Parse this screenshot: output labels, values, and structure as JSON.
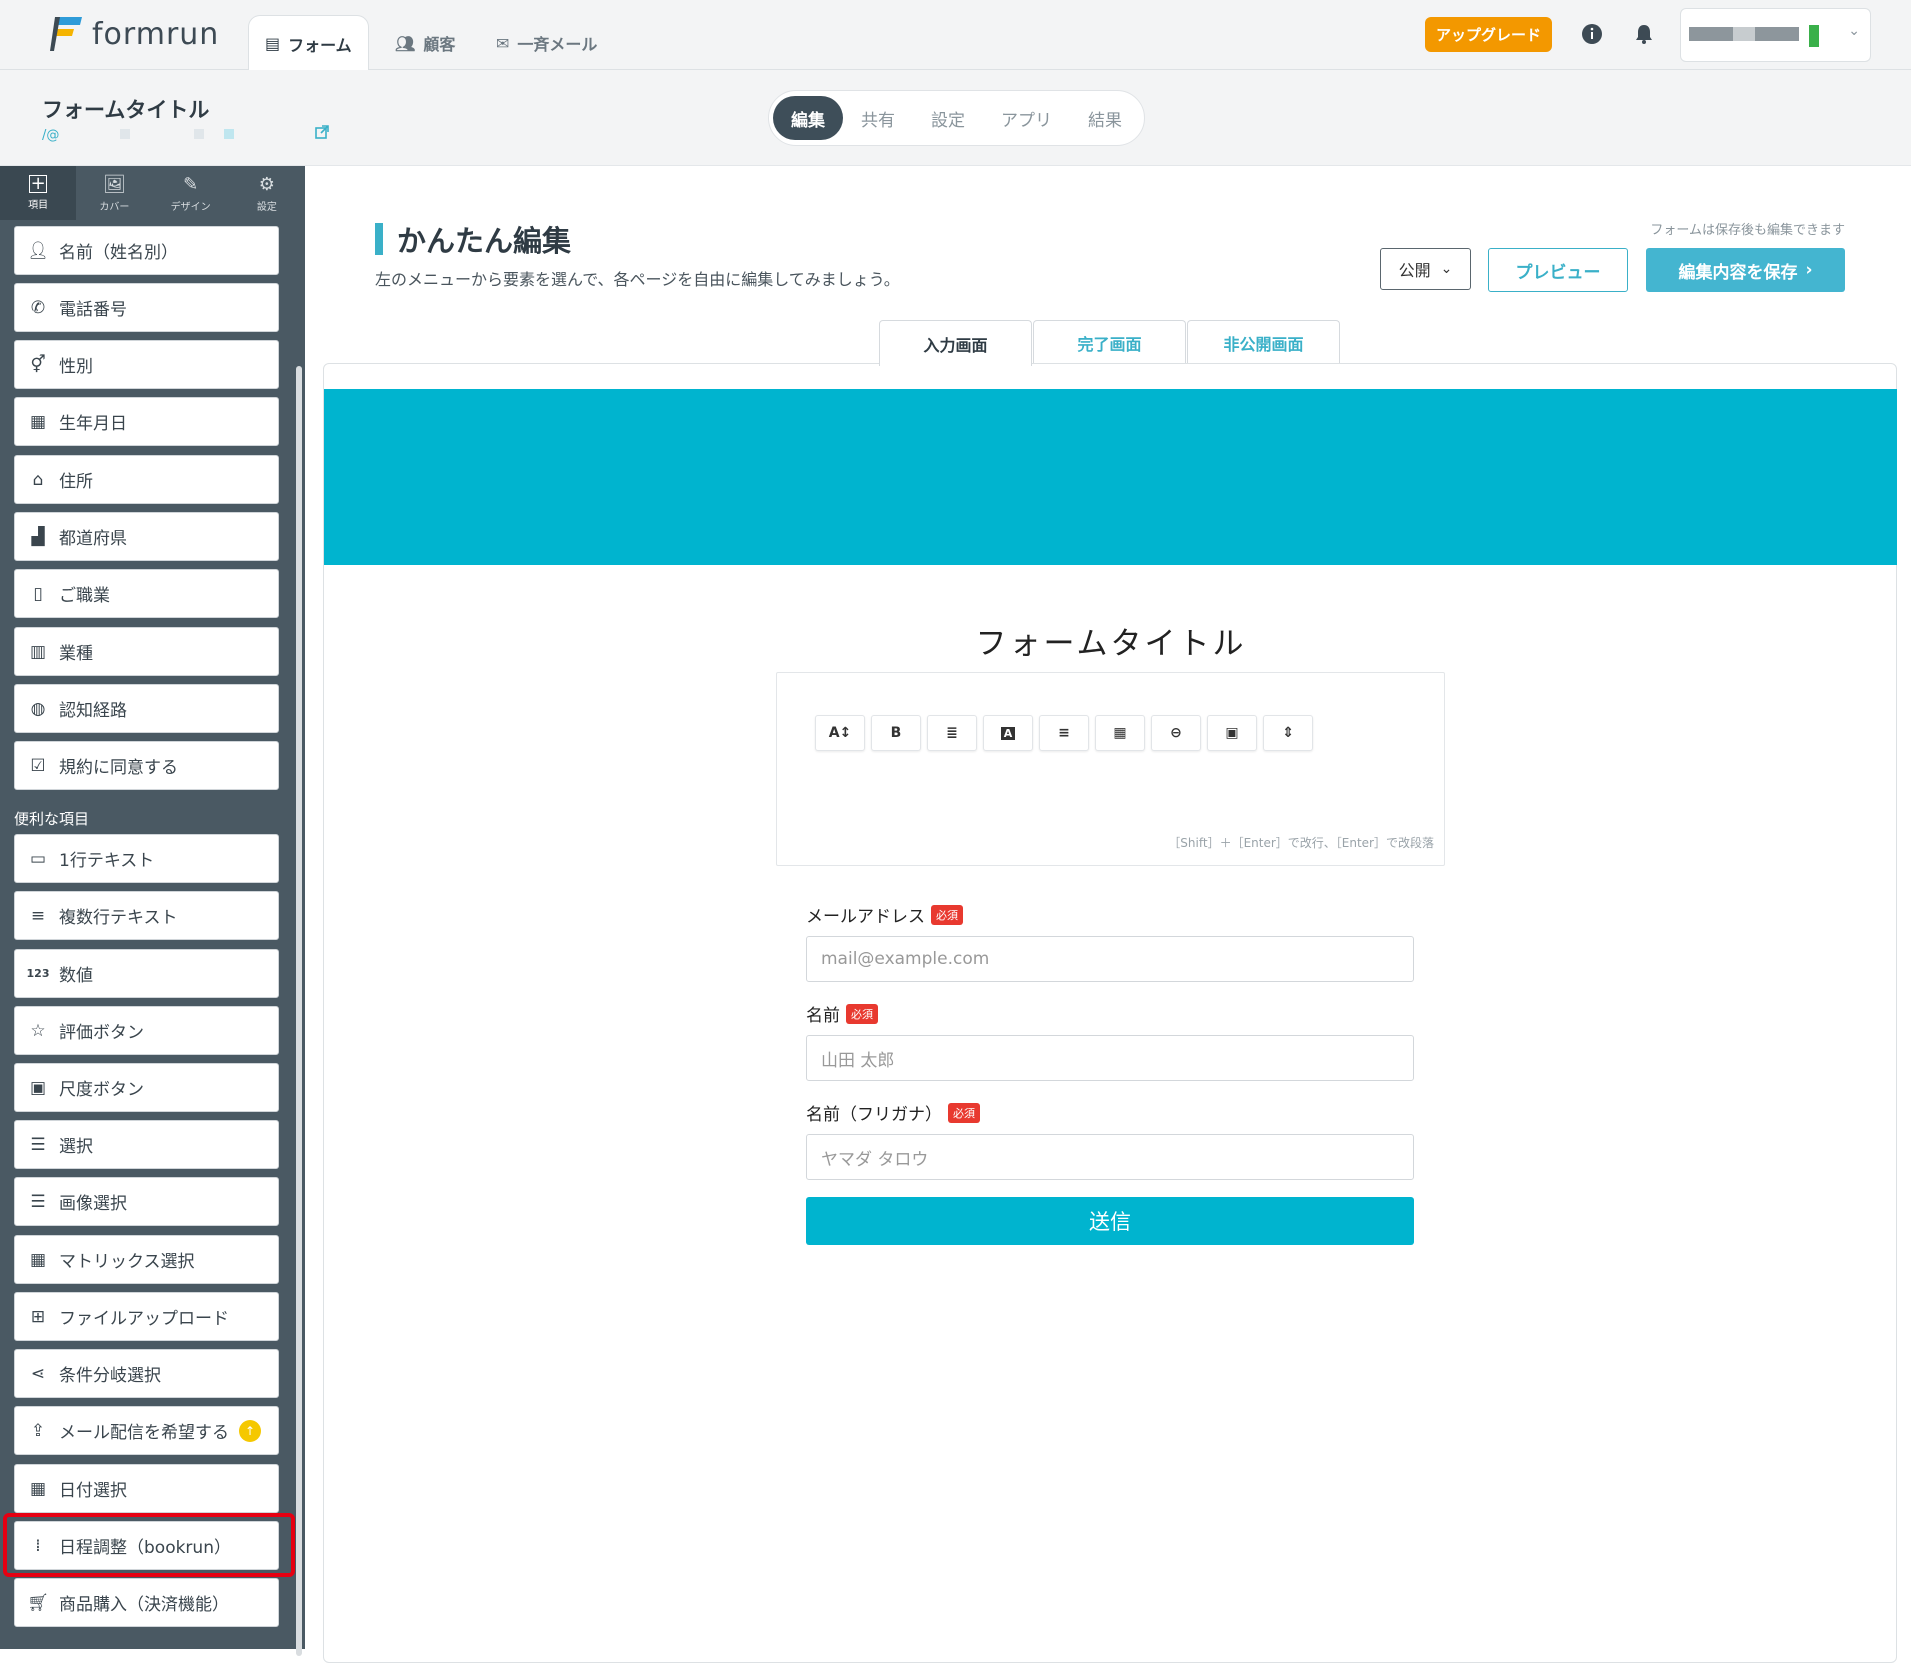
{
  "brand": {
    "name": "formrun"
  },
  "nav": {
    "tabs": [
      {
        "label": "フォーム",
        "icon": "form-icon"
      },
      {
        "label": "顧客",
        "icon": "people-icon"
      },
      {
        "label": "一斉メール",
        "icon": "mail-icon"
      }
    ],
    "upgrade_label": "アップグレード"
  },
  "form_header": {
    "title": "フォームタイトル",
    "url": "/@"
  },
  "segment": {
    "items": [
      "編集",
      "共有",
      "設定",
      "アプリ",
      "結果"
    ],
    "active": "編集"
  },
  "sidebar": {
    "tabs": [
      {
        "label": "項目",
        "icon": "add-icon"
      },
      {
        "label": "カバー",
        "icon": "image-icon"
      },
      {
        "label": "デザイン",
        "icon": "brush-icon"
      },
      {
        "label": "設定",
        "icon": "gear-icon"
      }
    ],
    "items": [
      {
        "label": "名前（姓名別）",
        "icon": "person-icon"
      },
      {
        "label": "電話番号",
        "icon": "phone-icon"
      },
      {
        "label": "性別",
        "icon": "gender-icon"
      },
      {
        "label": "生年月日",
        "icon": "calendar-icon"
      },
      {
        "label": "住所",
        "icon": "home-icon"
      },
      {
        "label": "都道府県",
        "icon": "map-icon"
      },
      {
        "label": "ご職業",
        "icon": "badge-icon"
      },
      {
        "label": "業種",
        "icon": "building-icon"
      },
      {
        "label": "認知経路",
        "icon": "globe-icon"
      },
      {
        "label": "規約に同意する",
        "icon": "checkbox-icon"
      }
    ],
    "section_label": "便利な項目",
    "extra_items": [
      {
        "label": "1行テキスト",
        "icon": "text-line-icon"
      },
      {
        "label": "複数行テキスト",
        "icon": "text-lines-icon"
      },
      {
        "label": "数値",
        "icon": "number-icon",
        "icon_text": "123"
      },
      {
        "label": "評価ボタン",
        "icon": "star-icon"
      },
      {
        "label": "尺度ボタン",
        "icon": "scale-icon"
      },
      {
        "label": "選択",
        "icon": "list-icon"
      },
      {
        "label": "画像選択",
        "icon": "list-icon"
      },
      {
        "label": "マトリックス選択",
        "icon": "table-icon"
      },
      {
        "label": "ファイルアップロード",
        "icon": "file-add-icon"
      },
      {
        "label": "条件分岐選択",
        "icon": "share-icon"
      },
      {
        "label": "メール配信を希望する",
        "icon": "mail-upload-icon"
      },
      {
        "label": "日付選択",
        "icon": "calendar-icon"
      },
      {
        "label": "日程調整（bookrun）",
        "icon": "dots-check-icon"
      },
      {
        "label": "商品購入（決済機能）",
        "icon": "cart-icon"
      }
    ]
  },
  "main": {
    "title": "かんたん編集",
    "description": "左のメニューから要素を選んで、各ページを自由に編集してみましょう。",
    "save_note": "フォームは保存後も編集できます",
    "publish_select": "公開",
    "preview_label": "プレビュー",
    "save_label": "編集内容を保存",
    "page_tabs": [
      "入力画面",
      "完了画面",
      "非公開画面"
    ]
  },
  "form": {
    "banner_color": "#00b4cf",
    "title": "フォームタイトル",
    "toolbar": [
      {
        "icon": "font-size-icon",
        "text": "A↕"
      },
      {
        "icon": "bold-icon",
        "text": "B"
      },
      {
        "icon": "bullet-list-icon",
        "text": "≣"
      },
      {
        "icon": "text-color-icon",
        "text": "A"
      },
      {
        "icon": "align-icon",
        "text": "≡"
      },
      {
        "icon": "table-icon",
        "text": "▦"
      },
      {
        "icon": "link-icon",
        "text": "⊖"
      },
      {
        "icon": "image-icon",
        "text": "▣"
      },
      {
        "icon": "divider-icon",
        "text": "⇕"
      }
    ],
    "editor_hint": "［Shift］＋［Enter］で改行、［Enter］で改段落",
    "required_label": "必須",
    "fields": [
      {
        "label": "メールアドレス",
        "placeholder": "mail@example.com"
      },
      {
        "label": "名前",
        "placeholder": "山田 太郎"
      },
      {
        "label": "名前（フリガナ）",
        "placeholder": "ヤマダ タロウ"
      }
    ],
    "submit_label": "送信"
  },
  "colors": {
    "accent": "#3ab0c8",
    "sidebar": "#4a5963",
    "upgrade": "#f39800",
    "required": "#e8392f",
    "highlight": "#e60012"
  }
}
